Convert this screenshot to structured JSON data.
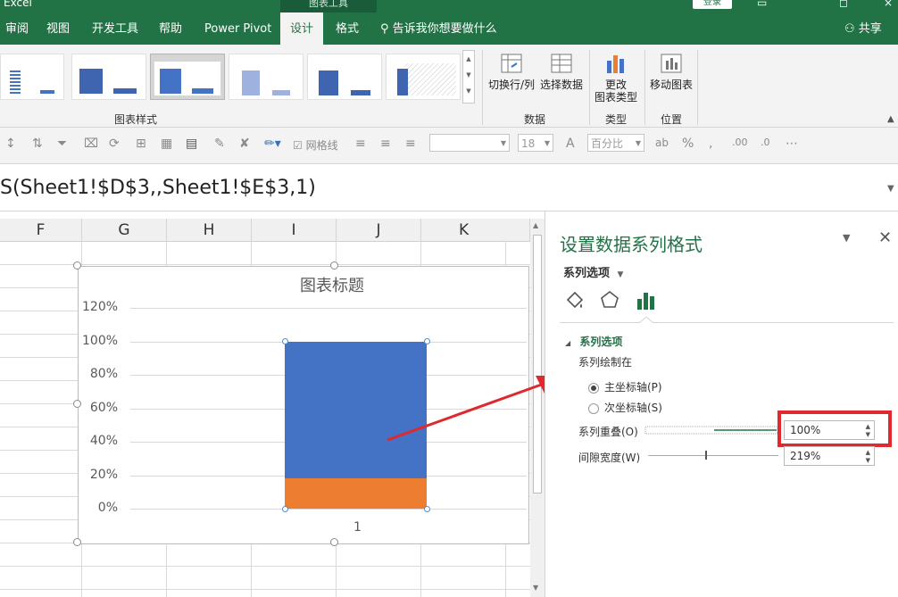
{
  "app": {
    "name": "Excel",
    "contextual_tab_group": "图表工具",
    "login_label": "登录"
  },
  "window_controls": [
    "▭",
    "◻",
    "×"
  ],
  "tabs": [
    {
      "label": "审阅",
      "active": false
    },
    {
      "label": "视图",
      "active": false
    },
    {
      "label": "开发工具",
      "active": false
    },
    {
      "label": "帮助",
      "active": false
    },
    {
      "label": "Power Pivot",
      "active": false
    },
    {
      "label": "设计",
      "active": true
    },
    {
      "label": "格式",
      "active": false
    }
  ],
  "tell_me": "告诉我你想要做什么",
  "share": "共享",
  "ribbon": {
    "groups": {
      "chart_styles": "图表样式",
      "data": "数据",
      "type": "类型",
      "location": "位置"
    },
    "buttons": {
      "switch_row_col": "切换行/列",
      "select_data": "选择数据",
      "change_type_line1": "更改",
      "change_type_line2": "图表类型",
      "move_chart": "移动图表"
    }
  },
  "format_bar": {
    "gridlines_label": "网格线",
    "font_size": "18",
    "number_format": "百分比"
  },
  "formula": "S(Sheet1!$D$3,,Sheet1!$E$3,1)",
  "columns": [
    "F",
    "G",
    "H",
    "I",
    "J",
    "K"
  ],
  "colors": {
    "accent": "#217346",
    "series1": "#4472c4",
    "series2": "#ed7d31",
    "highlight": "#e0282e"
  },
  "chart_data": {
    "type": "bar",
    "stacked": true,
    "title": "图表标题",
    "categories": [
      "1"
    ],
    "series": [
      {
        "values": [
          18
        ]
      },
      {
        "values": [
          82
        ]
      }
    ],
    "ylim": [
      0,
      120
    ],
    "ytick_labels": [
      "0%",
      "20%",
      "40%",
      "60%",
      "80%",
      "100%",
      "120%"
    ],
    "grid": true
  },
  "pane": {
    "title": "设置数据系列格式",
    "options_dropdown": "系列选项",
    "section": "系列选项",
    "plot_on": "系列绘制在",
    "primary_axis": "主坐标轴(P)",
    "secondary_axis": "次坐标轴(S)",
    "overlap_label": "系列重叠(O)",
    "overlap_value": "100%",
    "overlap_level": 100,
    "gap_label": "间隙宽度(W)",
    "gap_value": "219%",
    "gap_level": 0.44
  }
}
